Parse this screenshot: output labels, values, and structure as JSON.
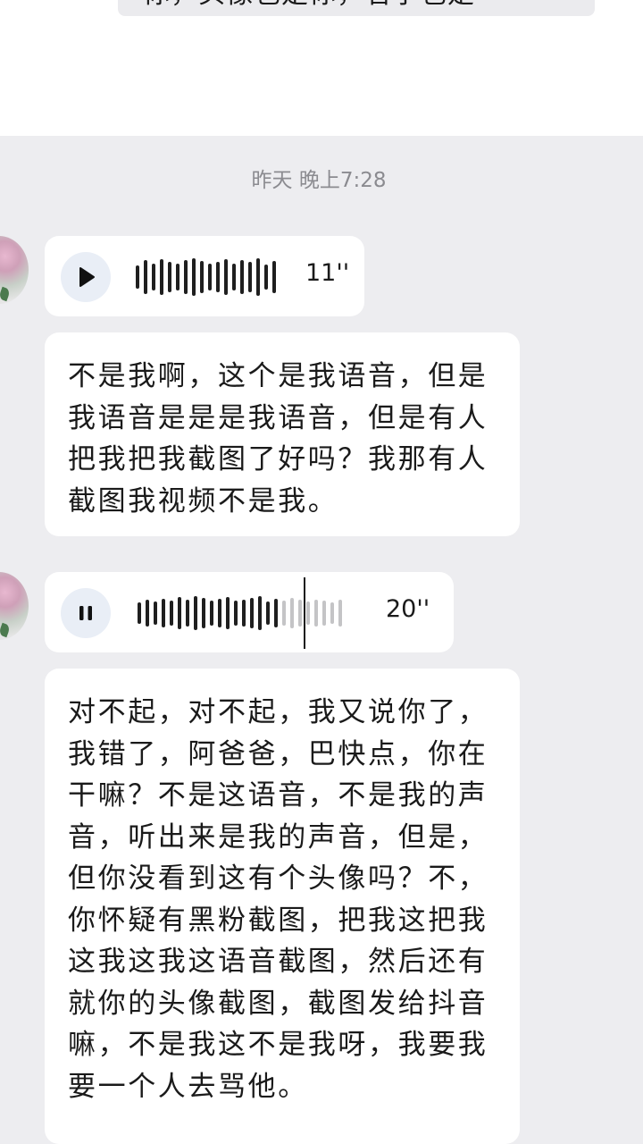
{
  "top_card": {
    "partial_text": "你，头像也是你，名字也是"
  },
  "timestamp": "昨天 晚上7:28",
  "messages": [
    {
      "type": "voice",
      "duration": "11''",
      "state": "paused",
      "progress": 0
    },
    {
      "type": "text",
      "text": "不是我啊，这个是我语音，但是我语音是是是我语音，但是有人把我把我截图了好吗？我那有人截图我视频不是我。"
    },
    {
      "type": "voice",
      "duration": "20''",
      "state": "playing",
      "progress": 0.7
    },
    {
      "type": "text",
      "text": "对不起，对不起，我又说你了，我错了，阿爸爸，巴快点，你在干嘛？不是这语音，不是我的声音，听出来是我的声音，但是，但你没看到这有个头像吗？不，你怀疑有黑粉截图，把我这把我这我这我这语音截图，然后还有就你的头像截图，截图发给抖音嘛，不是我这不是我呀，我要我要一个人去骂他。"
    }
  ],
  "icons": {
    "play": "play-icon",
    "pause": "pause-icon",
    "avatar": "contact-avatar"
  },
  "colors": {
    "chat_background": "#ededf0",
    "bubble": "#ffffff",
    "play_button": "#e9eef6",
    "wave_played": "#1f1f1f",
    "wave_unplayed": "#c4c4c6",
    "timestamp": "#8b8b90"
  }
}
